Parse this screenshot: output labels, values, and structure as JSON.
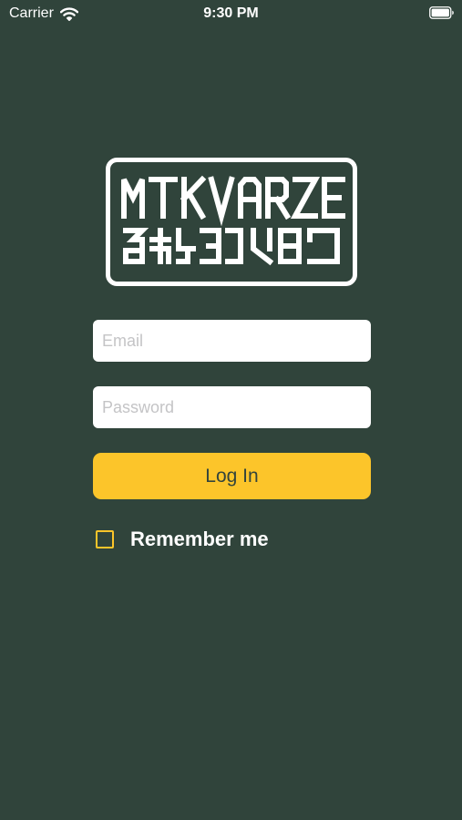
{
  "status_bar": {
    "carrier": "Carrier",
    "time": "9:30 PM",
    "icons": [
      "wifi-icon",
      "battery-icon"
    ]
  },
  "logo": {
    "top_text": "MTKVARZE",
    "bottom_text": "მტკვარზე"
  },
  "login_form": {
    "email_placeholder": "Email",
    "password_placeholder": "Password",
    "login_label": "Log In",
    "remember_label": "Remember me",
    "remember_checked": false
  },
  "colors": {
    "background": "#30443b",
    "accent": "#fcc52a",
    "button_text": "#33443c",
    "field_background": "#ffffff"
  }
}
